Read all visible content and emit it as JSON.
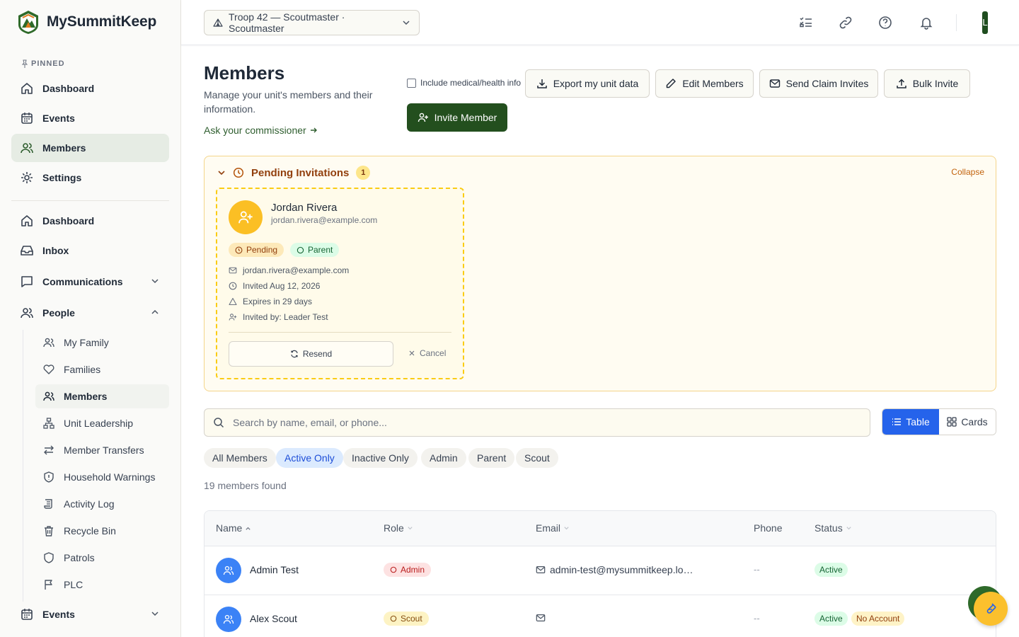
{
  "brand": {
    "name": "MySummitKeep",
    "logo_icon": "mountain-logo-icon"
  },
  "sidebar": {
    "pinned_label": "PINNED",
    "pinned": [
      {
        "label": "Dashboard",
        "icon": "home-icon"
      },
      {
        "label": "Events",
        "icon": "calendar-icon"
      },
      {
        "label": "Members",
        "icon": "users-icon",
        "active": true
      },
      {
        "label": "Settings",
        "icon": "gear-icon"
      }
    ],
    "main": [
      {
        "label": "Dashboard",
        "icon": "home-icon"
      },
      {
        "label": "Inbox",
        "icon": "inbox-icon"
      },
      {
        "label": "Communications",
        "icon": "message-icon",
        "expandable": true
      },
      {
        "label": "People",
        "icon": "users-icon",
        "expanded": true
      }
    ],
    "people_sub": [
      {
        "label": "My Family",
        "icon": "user-family-icon"
      },
      {
        "label": "Families",
        "icon": "heart-icon"
      },
      {
        "label": "Members",
        "icon": "users-icon",
        "active": true
      },
      {
        "label": "Unit Leadership",
        "icon": "org-chart-icon"
      },
      {
        "label": "Member Transfers",
        "icon": "transfer-arrows-icon"
      },
      {
        "label": "Household Warnings",
        "icon": "shield-alert-icon"
      },
      {
        "label": "Activity Log",
        "icon": "scroll-icon"
      },
      {
        "label": "Recycle Bin",
        "icon": "trash-icon"
      },
      {
        "label": "Patrols",
        "icon": "shield-icon"
      },
      {
        "label": "PLC",
        "icon": "flag-icon"
      }
    ],
    "events_label": "Events"
  },
  "topbar": {
    "unit": "Troop 42 — Scoutmaster · Scoutmaster",
    "avatar_letter": "L"
  },
  "header": {
    "title": "Members",
    "subtitle": "Manage your unit's members and their information.",
    "commissioner_link": "Ask your commissioner",
    "medical_checkbox": "Include medical/health info",
    "buttons": {
      "export": "Export my unit data",
      "edit": "Edit Members",
      "claim": "Send Claim Invites",
      "bulk": "Bulk Invite",
      "invite": "Invite Member"
    }
  },
  "pending": {
    "title": "Pending Invitations",
    "count": "1",
    "collapse": "Collapse",
    "invite": {
      "name": "Jordan Rivera",
      "email": "jordan.rivera@example.com",
      "status": "Pending",
      "role": "Parent",
      "detail_email": "jordan.rivera@example.com",
      "invited": "Invited Aug 12, 2026",
      "expires": "Expires in 29 days",
      "invited_by": "Invited by: Leader Test",
      "resend": "Resend",
      "cancel": "Cancel"
    }
  },
  "search": {
    "placeholder": "Search by name, email, or phone..."
  },
  "view": {
    "table": "Table",
    "cards": "Cards",
    "selected": "Table"
  },
  "filters": [
    "All Members",
    "Active Only",
    "Inactive Only",
    "Admin",
    "Parent",
    "Scout"
  ],
  "filter_selected": "Active Only",
  "results": "19 members found",
  "table": {
    "headers": {
      "name": "Name",
      "role": "Role",
      "email": "Email",
      "phone": "Phone",
      "status": "Status"
    },
    "rows": [
      {
        "name": "Admin Test",
        "role": "Admin",
        "email": "admin-test@mysummitkeep.lo…",
        "phone": "--",
        "status": "Active",
        "extra": ""
      },
      {
        "name": "Alex Scout",
        "role": "Scout",
        "email": "",
        "phone": "--",
        "status": "Active",
        "extra": "No Account"
      }
    ]
  },
  "colors": {
    "brand_green": "#234f1e",
    "accent_blue": "#2563eb",
    "pending_amber": "#92400e"
  }
}
